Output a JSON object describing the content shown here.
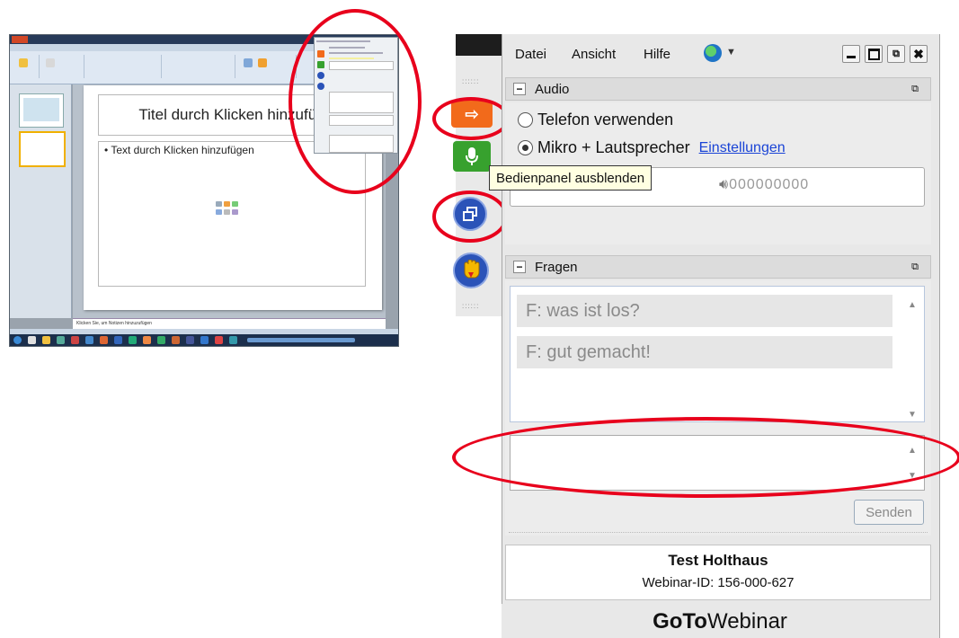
{
  "powerpoint": {
    "slide_title": "Titel durch Klicken hinzufüg",
    "slide_body": "• Text durch Klicken hinzufügen",
    "notes_placeholder": "Klicken Sie, um Notizen hinzuzufügen"
  },
  "side_toolbar": {
    "tooltip": "Bedienpanel ausblenden",
    "buttons": [
      "arrow-icon",
      "microphone-icon",
      "window-icon",
      "raise-hand-icon"
    ]
  },
  "menu": {
    "items": [
      "Datei",
      "Ansicht",
      "Hilfe"
    ],
    "window_controls": [
      "minimize",
      "maximize",
      "restore",
      "close"
    ]
  },
  "audio": {
    "title": "Audio",
    "option_phone": "Telefon verwenden",
    "option_mic": "Mikro + Lautsprecher",
    "settings_link": "Einstellungen",
    "selected": "Mikro + Lautsprecher",
    "mic_level": "000000000",
    "speaker_level": "000000000"
  },
  "questions": {
    "title": "Fragen",
    "items": [
      "F: was ist los?",
      "F: gut gemacht!"
    ],
    "send_label": "Senden"
  },
  "webinar": {
    "organizer": "Test Holthaus",
    "id_line": "Webinar-ID: 156-000-627",
    "brand_bold": "GoTo",
    "brand_rest": "Webinar"
  },
  "colors": {
    "annotation_red": "#e8001c",
    "orange_button": "#f26a1b",
    "green_button": "#37a12e",
    "blue_button": "#2b53b8",
    "link_blue": "#1a44d6"
  }
}
